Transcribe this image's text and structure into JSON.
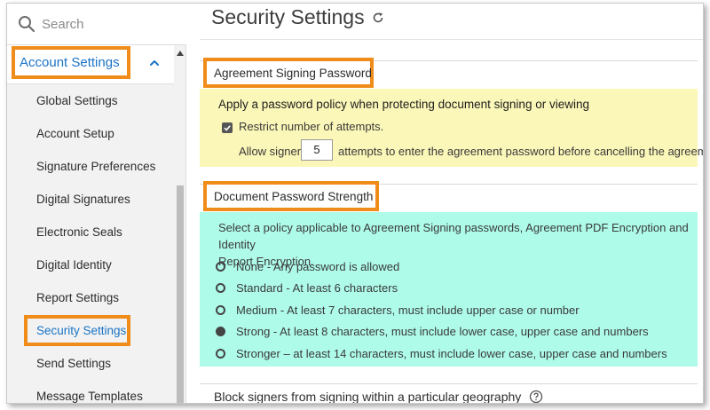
{
  "sidebar": {
    "search_placeholder": "Search",
    "group_label": "Account Settings",
    "items": [
      {
        "label": "Global Settings"
      },
      {
        "label": "Account Setup"
      },
      {
        "label": "Signature Preferences"
      },
      {
        "label": "Digital Signatures"
      },
      {
        "label": "Electronic Seals"
      },
      {
        "label": "Digital Identity"
      },
      {
        "label": "Report Settings"
      },
      {
        "label": "Security Settings",
        "active": true
      },
      {
        "label": "Send Settings"
      },
      {
        "label": "Message Templates"
      }
    ]
  },
  "main": {
    "title": "Security Settings",
    "agreement_password": {
      "title": "Agreement Signing Password",
      "heading": "Apply a password policy when protecting document signing or viewing",
      "restrict_label": "Restrict number of attempts.",
      "restrict_checked": true,
      "allow_prefix": "Allow signer",
      "attempts_value": "5",
      "allow_suffix": "attempts to enter the agreement password before cancelling the agreement."
    },
    "password_strength": {
      "title": "Document Password Strength",
      "description_line1": "Select a policy applicable to Agreement Signing passwords, Agreement PDF Encryption and Identity",
      "description_line2": "Report Encryption.",
      "options": [
        {
          "label": "None - Any password is allowed",
          "selected": false
        },
        {
          "label": "Standard - At least 6 characters",
          "selected": false
        },
        {
          "label": "Medium - At least 7 characters, must include upper case or number",
          "selected": false
        },
        {
          "label": "Strong - At least 8 characters, must include lower case, upper case and numbers",
          "selected": true
        },
        {
          "label": "Stronger – at least 14 characters, must include lower case, upper case and numbers",
          "selected": false
        }
      ]
    },
    "geography": {
      "label": "Block signers from signing within a particular geography"
    }
  },
  "colors": {
    "highlight": "#f08c1a",
    "link": "#1a73c6",
    "yellow_panel": "#fbf7b8",
    "cyan_panel": "#aefbea"
  },
  "icons": [
    "search-icon",
    "chevron-up-icon",
    "scroll-up-icon",
    "refresh-icon",
    "checkmark-icon",
    "help-icon"
  ]
}
